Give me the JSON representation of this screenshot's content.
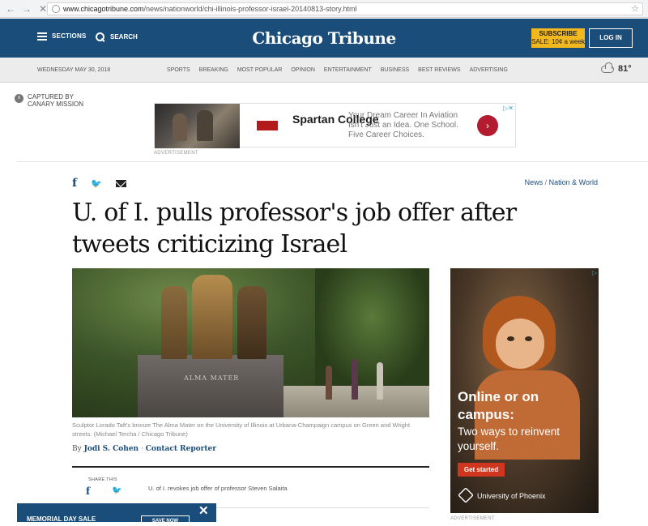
{
  "browser": {
    "url_host": "www.chicagotribune.com",
    "url_path": "/news/nationworld/chi-illinois-professor-israel-20140813-story.html"
  },
  "header": {
    "sections_label": "SECTIONS",
    "search_label": "SEARCH",
    "logo": "Chicago Tribune",
    "subscribe_line1": "SUBSCRIBE",
    "subscribe_line2": "SALE: 10¢ a week",
    "login_label": "LOG IN",
    "brand_color": "#1b4d7a",
    "accent_color": "#f2b81f"
  },
  "subnav": {
    "date": "WEDNESDAY MAY 30, 2018",
    "links": [
      "SPORTS",
      "BREAKING",
      "MOST POPULAR",
      "OPINION",
      "ENTERTAINMENT",
      "BUSINESS",
      "BEST REVIEWS",
      "ADVERTISING"
    ],
    "weather_temp": "81°",
    "weather_icon": "cloud-icon"
  },
  "captured": {
    "line1": "CAPTURED BY",
    "line2": "CANARY MISSION"
  },
  "top_ad": {
    "brand": "Spartan College",
    "copy": "Your Dream Career In Aviation Isn't Just an Idea. One School. Five Career Choices.",
    "arrow": "›",
    "label": "ADVERTISEMENT"
  },
  "article": {
    "breadcrumb_section": "News",
    "breadcrumb_sep": " / ",
    "breadcrumb_sub": "Nation & World",
    "headline": "U. of I. pulls professor's job offer after tweets criticizing Israel",
    "photo_inscription": "ALMA MATER",
    "caption": "Sculptor Lorado Taft's bronze The Alma Mater on the University of Illinois at Urbana-Champaign campus on Green and Wright streets. (Michael Tercha / Chicago Tribune)",
    "byline_prefix": "By ",
    "author": "Jodi S. Cohen",
    "byline_sep": " · ",
    "contact": "Contact Reporter",
    "share_label": "SHARE THIS",
    "related": "U. of I. revokes job offer of professor Steven Salaita"
  },
  "side_ad": {
    "title": "Online or on campus:",
    "subtitle": "Two ways to reinvent yourself.",
    "button": "Get started",
    "logo": "University of Phoenix",
    "label": "ADVERTISEMENT"
  },
  "bottom_banner": {
    "text": "MEMORIAL DAY SALE",
    "button": "SAVE NOW"
  }
}
